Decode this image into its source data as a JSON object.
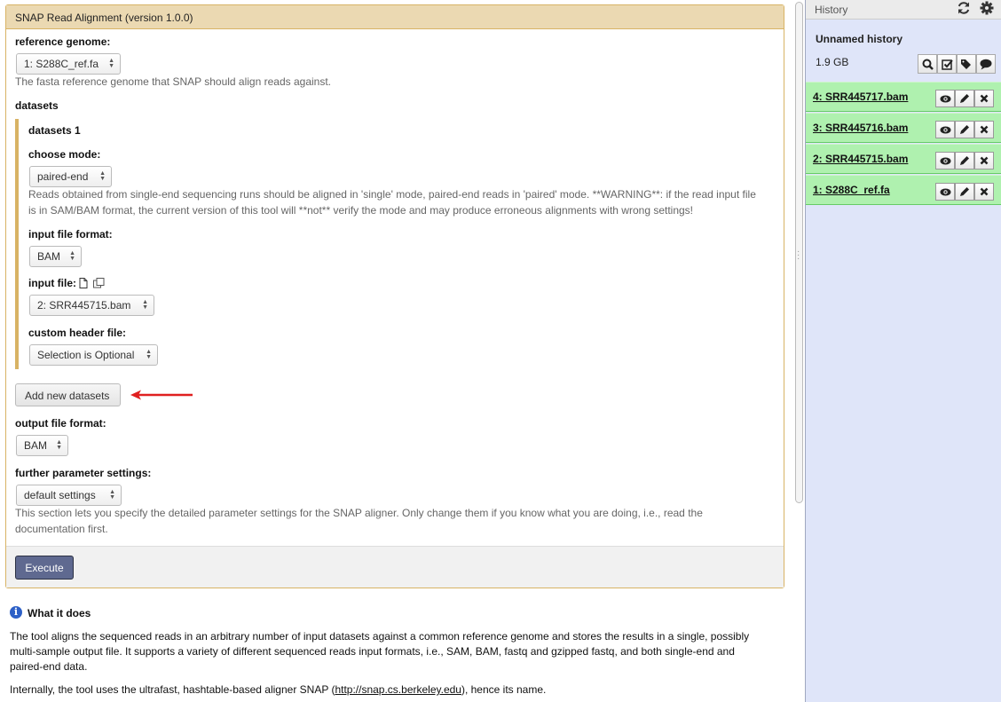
{
  "tool": {
    "title": "SNAP Read Alignment (version 1.0.0)",
    "reference_genome": {
      "label": "reference genome:",
      "value": "1: S288C_ref.fa",
      "help": "The fasta reference genome that SNAP should align reads against."
    },
    "datasets": {
      "label": "datasets",
      "group_title": "datasets 1",
      "choose_mode": {
        "label": "choose mode:",
        "value": "paired-end",
        "help_line1": "Reads obtained from single-end sequencing runs should be aligned in 'single' mode, paired-end reads in 'paired' mode. **WARNING**: if the read input file",
        "help_line2": "is in SAM/BAM format, the current version of this tool will **not** verify the mode and may produce erroneous alignments with wrong settings!"
      },
      "input_file_format": {
        "label": "input file format:",
        "value": "BAM"
      },
      "input_file": {
        "label": "input file:",
        "value": "2: SRR445715.bam"
      },
      "custom_header_file": {
        "label": "custom header file:",
        "value": "Selection is Optional"
      },
      "add_button": "Add new datasets"
    },
    "output_file_format": {
      "label": "output file format:",
      "value": "BAM"
    },
    "further_parameter_settings": {
      "label": "further parameter settings:",
      "value": "default settings",
      "help_line1": "This section lets you specify the detailed parameter settings for the SNAP aligner. Only change them if you know what you are doing, i.e., read the",
      "help_line2": "documentation first."
    },
    "execute_button": "Execute"
  },
  "what_it_does": {
    "heading": "What it does",
    "para1_line1": "The tool aligns the sequenced reads in an arbitrary number of input datasets against a common reference genome and stores the results in a single, possibly",
    "para1_line2": "multi-sample output file. It supports a variety of different sequenced reads input formats, i.e., SAM, BAM, fastq and gzipped fastq, and both single-end and",
    "para1_line3": "paired-end data.",
    "para2_prefix": "Internally, the tool uses the ultrafast, hashtable-based aligner SNAP (",
    "para2_link": "http://snap.cs.berkeley.edu",
    "para2_suffix": "), hence its name."
  },
  "history": {
    "header": "History",
    "name": "Unnamed history",
    "size": "1.9 GB",
    "items": [
      {
        "title": "4: SRR445717.bam"
      },
      {
        "title": "3: SRR445716.bam"
      },
      {
        "title": "2: SRR445715.bam"
      },
      {
        "title": "1: S288C_ref.fa"
      }
    ]
  },
  "colors": {
    "panel_border": "#d8b365",
    "panel_header": "#ebd9b2",
    "execute_bg": "#5f6990",
    "history_bg": "#dfe5f9",
    "dataset_ok": "#aff1af",
    "annotation_arrow": "#e02020"
  }
}
